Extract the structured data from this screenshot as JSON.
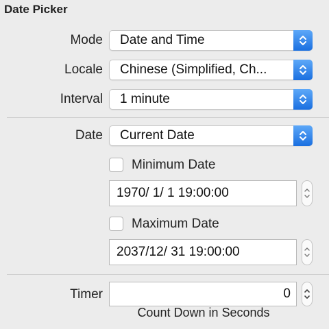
{
  "panel": {
    "title": "Date Picker"
  },
  "mode": {
    "label": "Mode",
    "value": "Date and Time"
  },
  "locale": {
    "label": "Locale",
    "value": "Chinese (Simplified, Ch..."
  },
  "interval": {
    "label": "Interval",
    "value": "1 minute"
  },
  "date": {
    "label": "Date",
    "value": "Current Date"
  },
  "minimum": {
    "checkbox_label": "Minimum Date",
    "checked": false,
    "value": "1970/  1/   1 19:00:00"
  },
  "maximum": {
    "checkbox_label": "Maximum Date",
    "checked": false,
    "value": "2037/12/ 31 19:00:00"
  },
  "timer": {
    "label": "Timer",
    "value": "0",
    "caption": "Count Down in Seconds"
  },
  "colors": {
    "accent": "#1a6fe0",
    "background": "#ececec"
  },
  "icons": {
    "popup": "up-down-chevron-icon",
    "stepper": "stepper-arrows-icon"
  }
}
